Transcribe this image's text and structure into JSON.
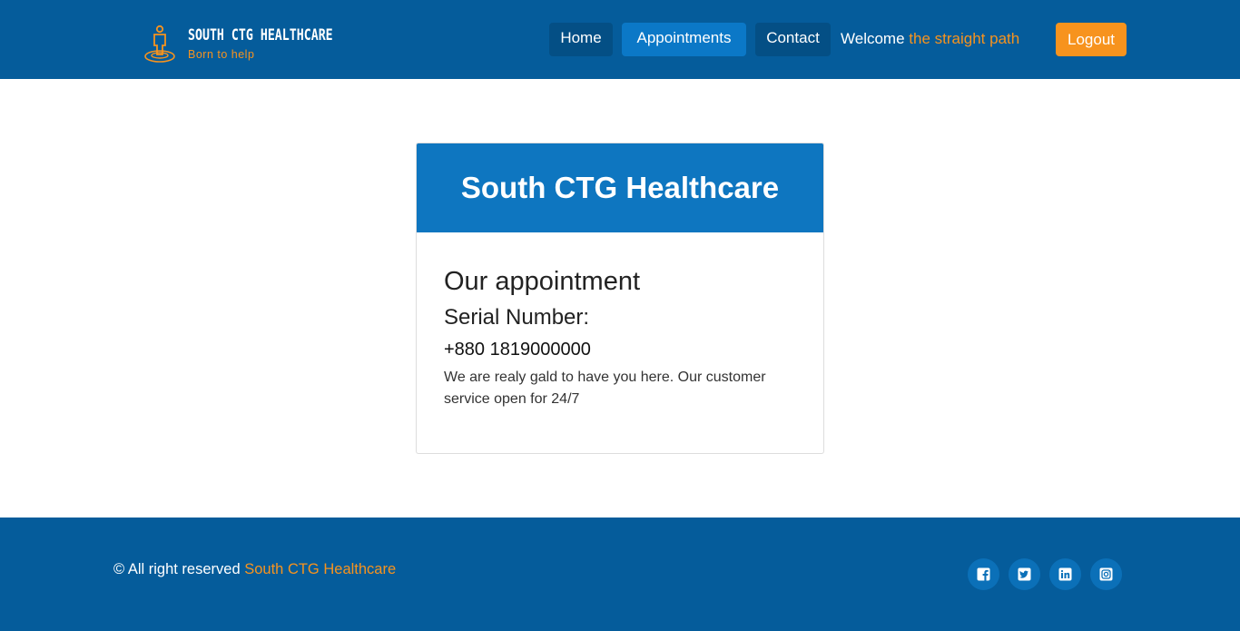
{
  "header": {
    "brand_name": "SOUTH CTG HEALTHCARE",
    "brand_tagline": "Born to help",
    "nav": {
      "home": "Home",
      "appointments": "Appointments",
      "contact": "Contact"
    },
    "welcome_prefix": "Welcome",
    "user_name": "the straight path",
    "logout_label": "Logout"
  },
  "card": {
    "header_title": "South CTG Healthcare",
    "title": "Our appointment",
    "serial_label": "Serial Number:",
    "phone": "+880 1819000000",
    "description": "We are realy gald to have you here. Our customer service open for 24/7"
  },
  "footer": {
    "copyright_prefix": "© All right reserved",
    "org_name": "South CTG Healthcare",
    "social_icons": [
      "facebook-icon",
      "twitter-icon",
      "linkedin-icon",
      "instagram-icon"
    ]
  },
  "colors": {
    "navbar": "#055c9b",
    "accent_orange": "#f7931e",
    "card_header": "#0e76c0",
    "active_nav": "#0b78c7"
  }
}
